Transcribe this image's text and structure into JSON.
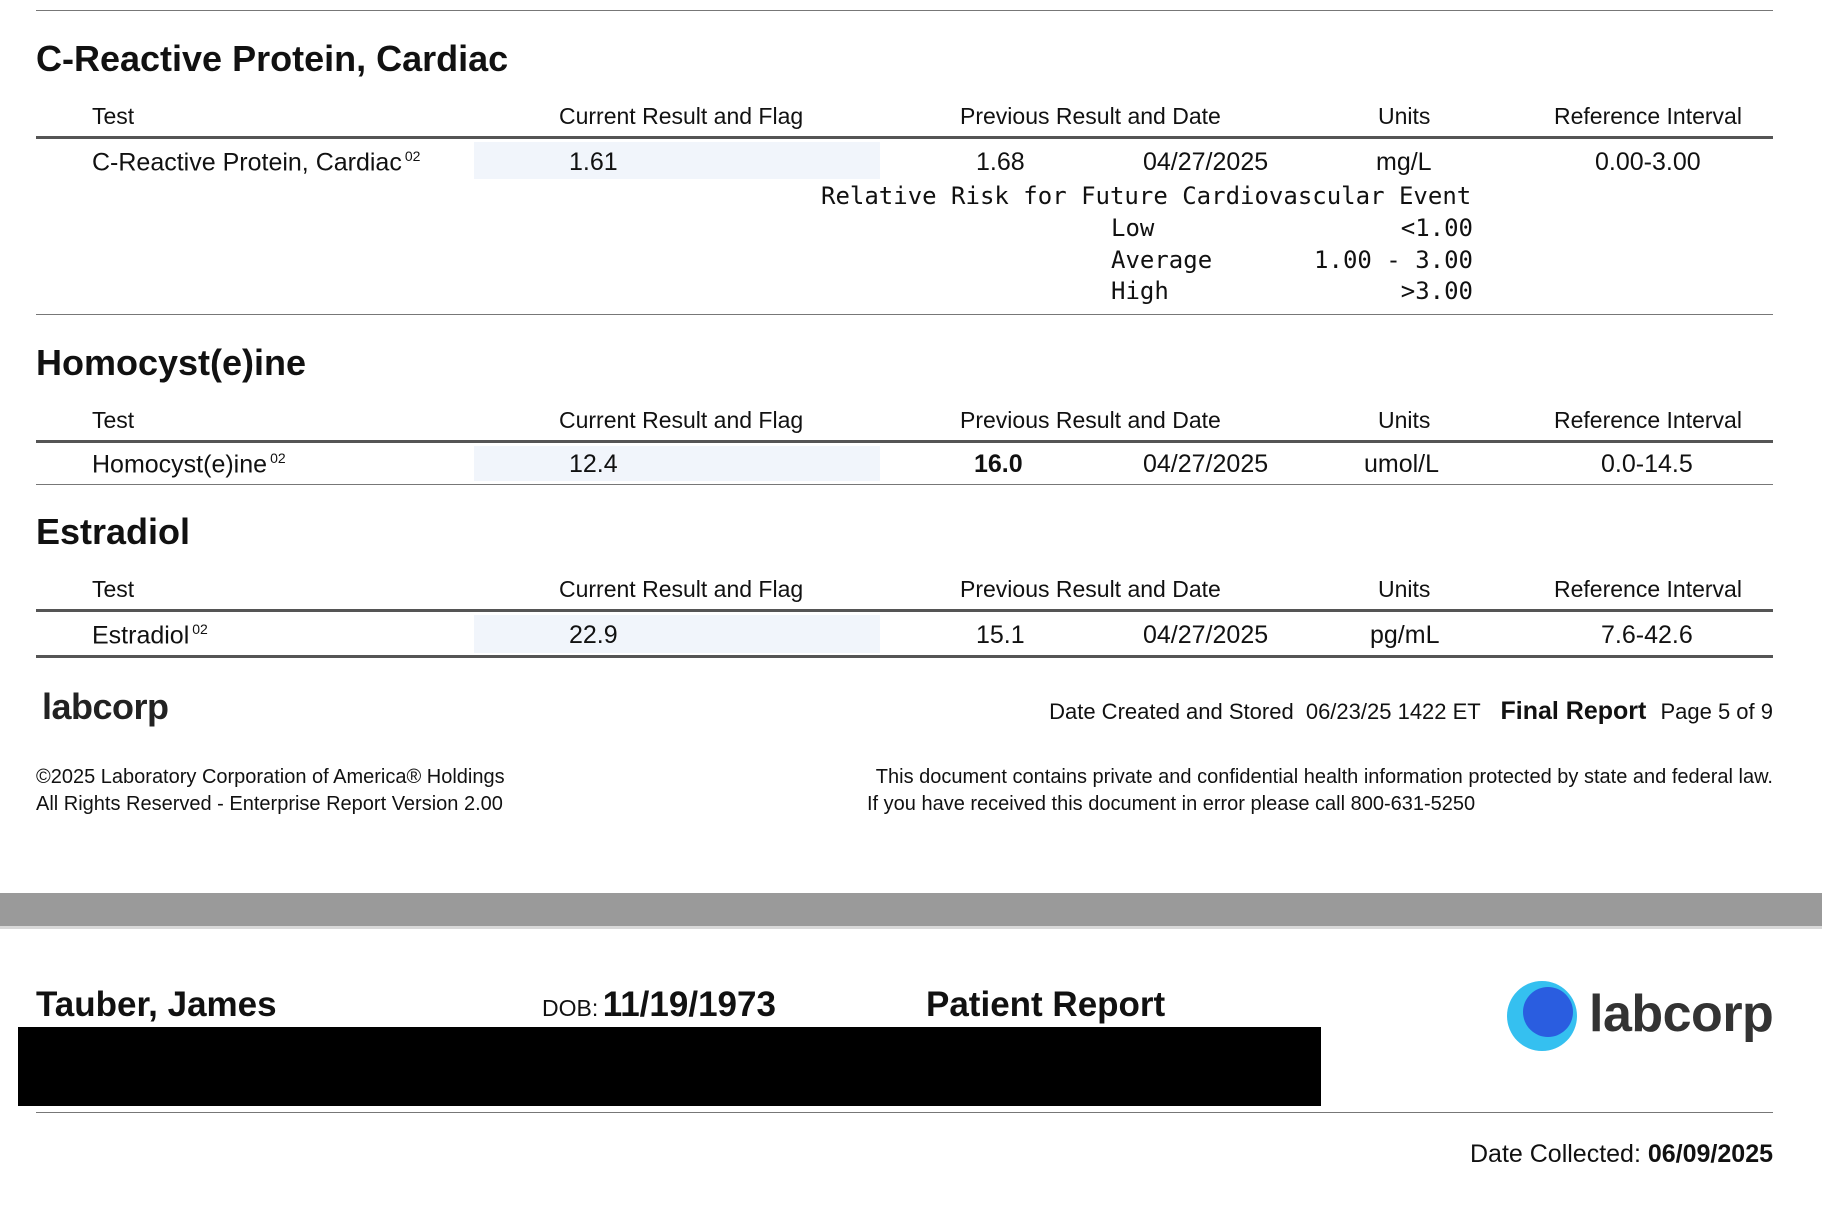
{
  "columns": {
    "test": "Test",
    "current": "Current Result and Flag",
    "previous": "Previous Result and Date",
    "units": "Units",
    "reference": "Reference Interval"
  },
  "sections": [
    {
      "title": "C-Reactive Protein, Cardiac",
      "row": {
        "test": "C-Reactive Protein, Cardiac",
        "sup": "02",
        "current": "1.61",
        "previous": "1.68",
        "prev_date": "04/27/2025",
        "units": "mg/L",
        "reference": "0.00-3.00"
      },
      "risk_note": {
        "heading": "Relative Risk for Future Cardiovascular Event",
        "rows": [
          {
            "label": "Low",
            "value": "<1.00"
          },
          {
            "label": "Average",
            "value": "1.00 - 3.00"
          },
          {
            "label": "High",
            "value": ">3.00"
          }
        ]
      }
    },
    {
      "title": "Homocyst(e)ine",
      "row": {
        "test": "Homocyst(e)ine",
        "sup": "02",
        "current": "12.4",
        "previous": "16.0",
        "prev_bold": true,
        "prev_date": "04/27/2025",
        "units": "umol/L",
        "reference": "0.0-14.5"
      }
    },
    {
      "title": "Estradiol",
      "row": {
        "test": "Estradiol",
        "sup": "02",
        "current": "22.9",
        "previous": "15.1",
        "prev_date": "04/27/2025",
        "units": "pg/mL",
        "reference": "7.6-42.6"
      }
    }
  ],
  "footer": {
    "logo_text": "labcorp",
    "date_created_label": "Date Created and Stored",
    "date_created_value": "06/23/25 1422 ET",
    "final_report": "Final Report",
    "page": "Page 5 of 9",
    "copyright_line1": "©2025 Laboratory Corporation of America® Holdings",
    "copyright_line2": "All Rights Reserved - Enterprise Report Version 2.00",
    "privacy_line1": "This document contains private and confidential health information protected by state and federal law.",
    "privacy_line2": "If you have received this document in error please call 800-631-5250"
  },
  "next_page": {
    "patient_name": "Tauber, James",
    "dob_label": "DOB:",
    "dob_value": "11/19/1973",
    "report_title": "Patient Report",
    "logo_text": "labcorp",
    "date_collected_label": "Date Collected:",
    "date_collected_value": "06/09/2025"
  },
  "colors": {
    "shade": "#f1f5fb",
    "page_break_gray": "#9a9a9a",
    "logo_blue_light": "#35c0f0",
    "logo_blue_dark": "#2a5de0"
  }
}
